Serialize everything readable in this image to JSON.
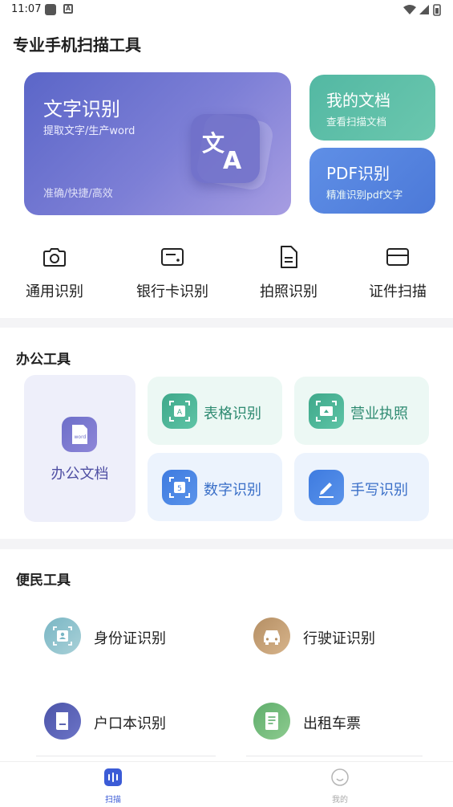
{
  "status_bar": {
    "time": "11:07"
  },
  "header": {
    "title": "专业手机扫描工具"
  },
  "hero": {
    "title": "文字识别",
    "subtitle": "提取文字/生产word",
    "tags": "准确/快捷/高效",
    "icon": "translate-icon"
  },
  "side_cards": [
    {
      "title": "我的文档",
      "subtitle": "查看扫描文档",
      "color": "#5bbfa7"
    },
    {
      "title": "PDF识别",
      "subtitle": "精准识别pdf文字",
      "color": "#5688e2"
    }
  ],
  "quick_actions": [
    {
      "label": "通用识别",
      "icon": "camera-icon"
    },
    {
      "label": "银行卡识别",
      "icon": "bank-card-icon"
    },
    {
      "label": "拍照识别",
      "icon": "document-icon"
    },
    {
      "label": "证件扫描",
      "icon": "id-card-icon"
    }
  ],
  "office": {
    "title": "办公工具",
    "main_tile": {
      "label": "办公文档",
      "badge": "word"
    },
    "tiles": [
      {
        "label": "表格识别",
        "icon": "table-scan-icon",
        "glyph": "A"
      },
      {
        "label": "营业执照",
        "icon": "license-icon"
      },
      {
        "label": "数字识别",
        "icon": "number-scan-icon",
        "glyph": "5"
      },
      {
        "label": "手写识别",
        "icon": "pen-icon"
      }
    ]
  },
  "services": {
    "title": "便民工具",
    "items": [
      {
        "label": "身份证识别",
        "icon": "id-card-icon"
      },
      {
        "label": "行驶证识别",
        "icon": "car-icon"
      },
      {
        "label": "户口本识别",
        "icon": "booklet-icon"
      },
      {
        "label": "出租车票",
        "icon": "receipt-icon"
      }
    ]
  },
  "tabbar": {
    "items": [
      {
        "label": "扫描",
        "icon": "scan-icon",
        "active": true
      },
      {
        "label": "我的",
        "icon": "smile-icon",
        "active": false
      }
    ],
    "active_color": "#3b5bd6"
  }
}
